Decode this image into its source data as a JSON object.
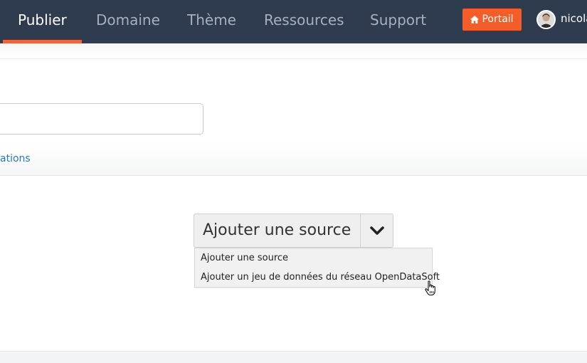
{
  "navbar": {
    "items": [
      {
        "label": "Publier",
        "active": true
      },
      {
        "label": "Domaine",
        "active": false
      },
      {
        "label": "Thème",
        "active": false
      },
      {
        "label": "Ressources",
        "active": false
      },
      {
        "label": "Support",
        "active": false
      }
    ],
    "portal_button": {
      "label": "Portail",
      "icon": "home-icon"
    },
    "user": {
      "name": "nicola"
    },
    "colors": {
      "background": "#2f3c4f",
      "accent": "#f35d2a",
      "active_text": "#ffffff",
      "inactive_text": "#a7b0bc"
    }
  },
  "tabs": {
    "partial_label": "ations"
  },
  "add_source": {
    "button_label": "Ajouter une source",
    "toggle_icon": "chevron-down-icon",
    "menu": [
      {
        "label": "Ajouter une source"
      },
      {
        "label": "Ajouter un jeu de données du réseau OpenDataSoft"
      }
    ]
  }
}
